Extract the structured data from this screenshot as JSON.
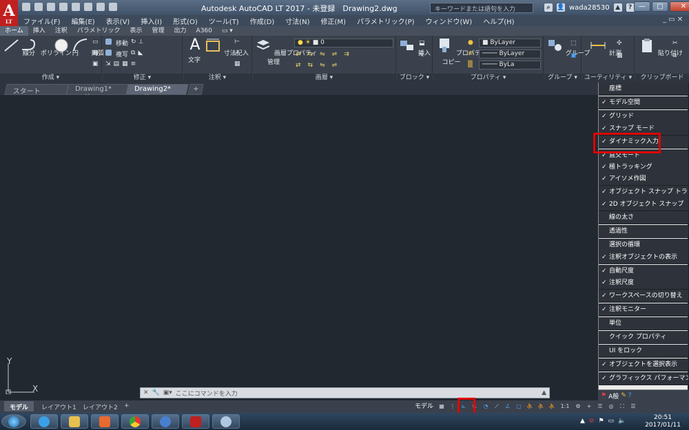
{
  "titlebar": {
    "app_letter": "A",
    "lt_label": "LT",
    "title": "Autodesk AutoCAD LT 2017 - 未登録　Drawing2.dwg",
    "search_placeholder": "キーワードまたは語句を入力",
    "user": "wada28530",
    "minimize": "—",
    "restore": "□",
    "close": "✕"
  },
  "menu": {
    "items": [
      "ファイル(F)",
      "編集(E)",
      "表示(V)",
      "挿入(I)",
      "形式(O)",
      "ツール(T)",
      "作成(D)",
      "寸法(N)",
      "修正(M)",
      "パラメトリック(P)",
      "ウィンドウ(W)",
      "ヘルプ(H)"
    ],
    "window_controls": "_ ▭ ✕"
  },
  "ribbon_tabs": [
    "ホーム",
    "挿入",
    "注釈",
    "パラメトリック",
    "表示",
    "管理",
    "出力",
    "A360",
    "▭ ▾"
  ],
  "ribbon": {
    "draw": {
      "title": "作成 ▾",
      "line": "線分",
      "polyline": "ポリライン",
      "circle": "円",
      "arc": "円弧"
    },
    "modify": {
      "title": "修正 ▾",
      "move": "移動",
      "copy": "複写"
    },
    "annotation": {
      "title": "注釈 ▾",
      "text": "文字",
      "dim": "寸法記入"
    },
    "layers": {
      "title": "画層 ▾",
      "props": "画層プロパティ",
      "props2": "管理",
      "layer_value": "0"
    },
    "block": {
      "title": "ブロック ▾",
      "insert": "挿入"
    },
    "properties": {
      "title": "プロパティ ▾",
      "match": "プロパティ",
      "match2": "コピー",
      "bylayer1": "ByLayer",
      "bylayer2": "ByLayer",
      "bylayer3": "ByLa"
    },
    "groups": {
      "title": "グループ ▾",
      "group": "グループ"
    },
    "utilities": {
      "title": "ユーティリティ ▾",
      "measure": "計測"
    },
    "clipboard": {
      "title": "クリップボード",
      "paste": "貼り付け"
    }
  },
  "doc_tabs": {
    "start": "スタート",
    "drawing1": "Drawing1*",
    "drawing2": "Drawing2*",
    "add": "+"
  },
  "canvas": {
    "ucs_y": "Y",
    "ucs_x": "X",
    "command_placeholder": "ここにコマンドを入力"
  },
  "layout_tabs": {
    "model": "モデル",
    "layout1": "レイアウト1",
    "layout2": "レイアウト2",
    "add": "+"
  },
  "statusbar": {
    "model": "モデル",
    "scale": "1:1"
  },
  "customization_menu": {
    "items": [
      {
        "label": "座標",
        "checked": false
      },
      {
        "label": "モデル空間",
        "checked": true
      },
      {
        "label": "グリッド",
        "checked": true
      },
      {
        "label": "スナップ モード",
        "checked": true
      },
      {
        "label": "ダイナミック入力",
        "checked": true
      },
      {
        "label": "直交モード",
        "checked": true
      },
      {
        "label": "極トラッキング",
        "checked": true
      },
      {
        "label": "アイソメ作図",
        "checked": true
      },
      {
        "label": "オブジェクト スナップ トラッキング",
        "checked": true
      },
      {
        "label": "2D オブジェクト スナップ",
        "checked": true
      },
      {
        "label": "線の太さ",
        "checked": false
      },
      {
        "label": "透過性",
        "checked": false
      },
      {
        "label": "選択の循環",
        "checked": false
      },
      {
        "label": "注釈オブジェクトの表示",
        "checked": true
      },
      {
        "label": "自動尺度",
        "checked": true
      },
      {
        "label": "注釈尺度",
        "checked": true
      },
      {
        "label": "ワークスペースの切り替え",
        "checked": true
      },
      {
        "label": "注釈モニター",
        "checked": true
      },
      {
        "label": "単位",
        "checked": false
      },
      {
        "label": "クイック プロパティ",
        "checked": false
      },
      {
        "label": "UI をロック",
        "checked": false
      },
      {
        "label": "オブジェクトを選択表示",
        "checked": true
      },
      {
        "label": "グラフィックス パフォーマンス",
        "checked": true
      }
    ],
    "check_mark": "✓"
  },
  "bottom_right": {
    "ime": "A般"
  },
  "taskbar": {
    "time": "20:51",
    "date": "2017/01/11"
  },
  "colors": {
    "highlight": "#e00000",
    "canvas": "#212830",
    "menu_bg": "#2e333b"
  }
}
